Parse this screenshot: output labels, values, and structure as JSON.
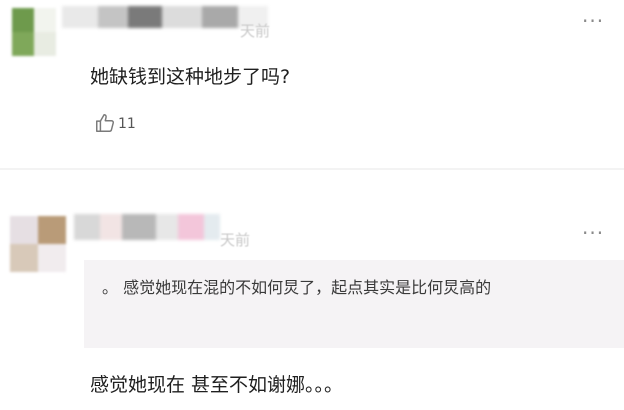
{
  "comments": [
    {
      "time": "天前",
      "text": "她缺钱到这种地步了吗?",
      "likes": "11",
      "more_icon": "ellipsis-icon",
      "like_icon": "thumb-up-icon",
      "avatar_colors": [
        "#6e9a4c",
        "#f2f4ee",
        "#7fa85a",
        "#e8ece2"
      ],
      "nick_colors": [
        "#e9e9e9",
        "#c4c4c4",
        "#7a7a7a",
        "#dcdcdc",
        "#a9a9a9",
        "#f0f0f0"
      ]
    },
    {
      "time": "天前",
      "quote": "。 感觉她现在混的不如何炅了，起点其实是比何炅高的",
      "text": "感觉她现在 甚至不如谢娜。。。",
      "more_icon": "ellipsis-icon",
      "avatar_colors": [
        "#e6dfe3",
        "#b99b78",
        "#d8c9b9",
        "#f1ecee"
      ],
      "nick_colors": [
        "#d8d8d8",
        "#f2e4e4",
        "#b8b8b8",
        "#e7e7e7",
        "#f3c6da",
        "#e4ebef"
      ]
    }
  ]
}
